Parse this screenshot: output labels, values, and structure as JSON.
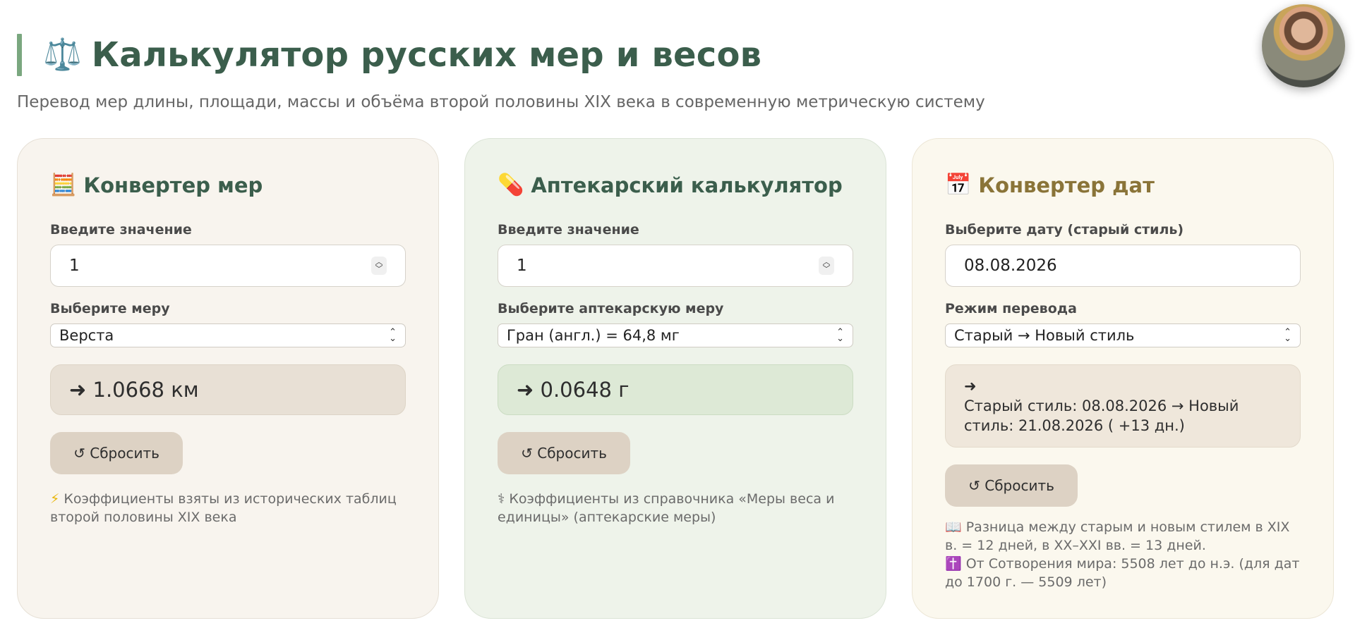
{
  "header": {
    "title_icon": "⚖️",
    "title": "Калькулятор русских мер и весов",
    "subtitle": "Перевод мер длины, площади, массы и объёма второй половины XIX века в современную метрическую систему"
  },
  "converter": {
    "icon": "🧮",
    "title": "Конвертер мер",
    "value_label": "Введите значение",
    "value": "1",
    "measure_label": "Выберите меру",
    "measure_selected": "Верста",
    "result": "➜ 1.0668 км",
    "reset_label": "↺ Сбросить",
    "note_icon": "⚡",
    "note": "Коэффициенты взяты из исторических таблиц второй половины XIX века"
  },
  "apothecary": {
    "icon": "💊",
    "title": "Аптекарский калькулятор",
    "value_label": "Введите значение",
    "value": "1",
    "measure_label": "Выберите аптекарскую меру",
    "measure_selected": "Гран (англ.) = 64,8 мг",
    "result": "➜ 0.0648 г",
    "reset_label": "↺ Сбросить",
    "note_icon": "⚕",
    "note": "Коэффициенты из справочника «Меры веса и единицы» (аптекарские меры)"
  },
  "dates": {
    "icon": "📅",
    "title": "Конвертер дат",
    "date_label": "Выберите дату (старый стиль)",
    "date_value": "08.08.2026",
    "mode_label": "Режим перевода",
    "mode_selected": "Старый → Новый стиль",
    "result_arrow": "➜",
    "result_line1": "Старый стиль: 08.08.2026 → Новый",
    "result_line2": "стиль: 21.08.2026 ( +13 дн.)",
    "reset_label": "↺ Сбросить",
    "note1_icon": "📖",
    "note1": "Разница между старым и новым стилем в XIX в. = 12 дней, в XX–XXI вв. = 13 дней.",
    "note2_icon": "✝️",
    "note2": "От Сотворения мира: 5508 лет до н.э. (для дат до 1700 г. — 5509 лет)"
  },
  "colors": {
    "accent": "#3b5e4c",
    "date_accent": "#8a7438",
    "title_bar": "#7aa77f"
  }
}
